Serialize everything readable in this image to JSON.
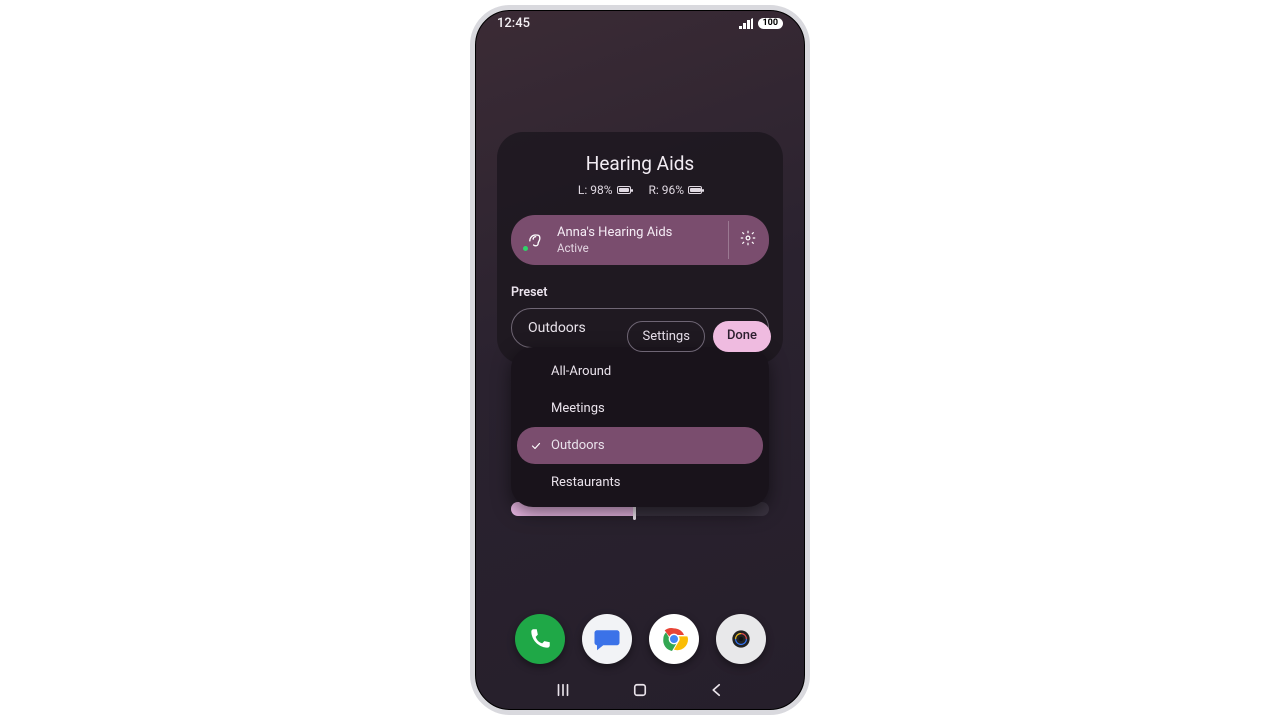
{
  "status_bar": {
    "time": "12:45",
    "battery": "100"
  },
  "panel": {
    "title": "Hearing Aids",
    "left_battery_label": "L: 98%",
    "right_battery_label": "R: 96%",
    "left_battery_pct": 98,
    "right_battery_pct": 96,
    "device": {
      "name": "Anna's Hearing Aids",
      "status": "Active"
    },
    "preset_label": "Preset",
    "preset_selected": "Outdoors",
    "preset_options": {
      "0": "All-Around",
      "1": "Meetings",
      "2": "Outdoors",
      "3": "Restaurants"
    },
    "footer": {
      "settings": "Settings",
      "done": "Done"
    },
    "slider_value_pct": 48
  }
}
